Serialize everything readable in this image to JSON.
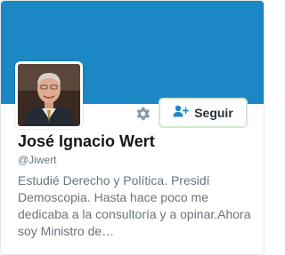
{
  "profile": {
    "name": "José Ignacio Wert",
    "handle": "@Jiwert",
    "bio": "Estudié Derecho y Política. Presidí Demoscopia. Hasta hace poco me dedicaba a la consultoría y a opinar.Ahora soy Ministro de…"
  },
  "actions": {
    "follow_label": "Seguir",
    "settings_icon": "gear-icon",
    "follow_icon": "add-user-icon"
  },
  "colors": {
    "banner": "#1b87c4",
    "follow_border": "#d3e9cf",
    "follow_icon": "#1b87c4",
    "name": "#14171a",
    "secondary_text": "#66757f"
  }
}
